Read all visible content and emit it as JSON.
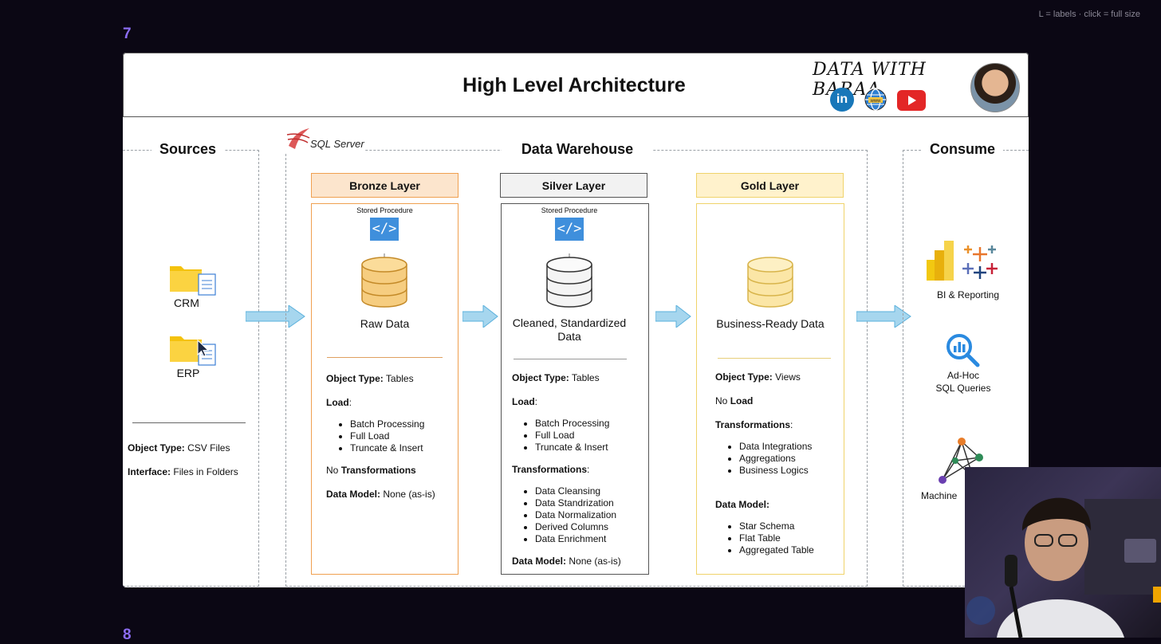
{
  "hint": "L = labels · click = full size",
  "slide_numbers": {
    "top": "7",
    "bottom": "8"
  },
  "header": {
    "title": "High Level Architecture",
    "brand": "DATA WITH BARAA",
    "social_icons": [
      "linkedin-icon",
      "globe-icon",
      "youtube-icon"
    ]
  },
  "sources": {
    "title": "Sources",
    "items": [
      {
        "label": "CRM",
        "icon": "folder-icon"
      },
      {
        "label": "ERP",
        "icon": "folder-icon"
      }
    ],
    "object_type_label": "Object Type:",
    "object_type_value": "CSV Files",
    "interface_label": "Interface:",
    "interface_value": "Files in Folders"
  },
  "warehouse": {
    "title": "Data Warehouse",
    "platform": "SQL Server",
    "stored_procedure": "Stored Procedure",
    "layers": [
      {
        "name": "Bronze Layer",
        "head_color": "#fce5cd",
        "border_color": "#f0a050",
        "db_color": "#f6cd80",
        "caption": "Raw Data",
        "object_type": "Tables",
        "load_label": "Load",
        "load_items": [
          "Batch Processing",
          "Full Load",
          "Truncate & Insert"
        ],
        "transform_prefix": "No",
        "transform_label": "Transformations",
        "data_model_label": "Data Model:",
        "data_model_value": "None (as-is)"
      },
      {
        "name": "Silver Layer",
        "head_color": "#f2f2f2",
        "border_color": "#555555",
        "db_color": "#f2f2f2",
        "caption": "Cleaned, Standardized Data",
        "object_type": "Tables",
        "load_label": "Load",
        "load_items": [
          "Batch Processing",
          "Full Load",
          "Truncate & Insert"
        ],
        "transform_label": "Transformations",
        "transform_items": [
          "Data Cleansing",
          "Data Standrization",
          "Data Normalization",
          "Derived Columns",
          "Data Enrichment"
        ],
        "data_model_label": "Data Model:",
        "data_model_value": "None (as-is)"
      },
      {
        "name": "Gold Layer",
        "head_color": "#fff2cc",
        "border_color": "#f0d36a",
        "db_color": "#fbe6a6",
        "caption": "Business-Ready Data",
        "object_type": "Views",
        "load_prefix": "No",
        "load_label": "Load",
        "transform_label": "Transformations",
        "transform_items": [
          "Data Integrations",
          "Aggregations",
          "Business Logics"
        ],
        "data_model_label": "Data Model:",
        "data_model_items": [
          "Star Schema",
          "Flat Table",
          "Aggregated Table"
        ]
      }
    ],
    "object_type_label": "Object Type:"
  },
  "consume": {
    "title": "Consume",
    "items": [
      {
        "label": "BI & Reporting",
        "icon": "bi-tools-icon"
      },
      {
        "label": "Ad-Hoc\nSQL Queries",
        "icon": "query-analytics-icon"
      },
      {
        "label": "Machine",
        "icon": "network-graph-icon"
      }
    ]
  }
}
